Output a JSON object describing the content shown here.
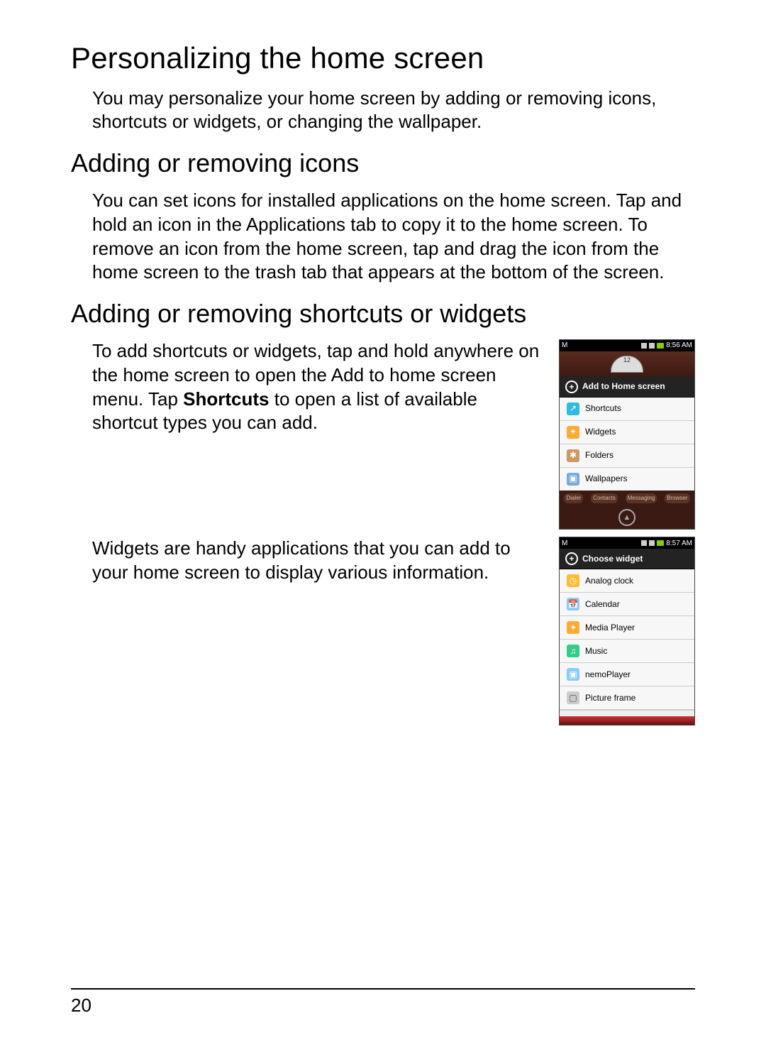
{
  "page_number": "20",
  "h1": "Personalizing the home screen",
  "intro": "You may personalize your home screen by adding or removing icons, shortcuts or widgets, or changing the wallpaper.",
  "h2a": "Adding or removing icons",
  "para_a": "You can set icons for installed applications on the home screen. Tap and hold an icon in the Applications tab to copy it to the home screen. To remove an icon from the home screen, tap and drag the icon from the home screen to the trash tab that appears at the bottom of the screen.",
  "h2b": "Adding or removing shortcuts or widgets",
  "para_b_pre": "To add shortcuts or widgets, tap and hold anywhere on the home screen to open the Add to home screen menu. Tap ",
  "para_b_bold": "Shortcuts",
  "para_b_post": " to open a list of available shortcut types you can add.",
  "para_c": "Widgets are handy applications that you can add to your home screen to display various information.",
  "phone1": {
    "time": "8:56 AM",
    "clock_num": "12",
    "header": "Add to Home screen",
    "items": [
      "Shortcuts",
      "Widgets",
      "Folders",
      "Wallpapers"
    ],
    "quick": [
      "Dialer",
      "Contacts",
      "Messaging",
      "Browser"
    ]
  },
  "phone2": {
    "time": "8:57 AM",
    "header": "Choose widget",
    "items": [
      "Analog clock",
      "Calendar",
      "Media Player",
      "Music",
      "nemoPlayer",
      "Picture frame"
    ]
  }
}
